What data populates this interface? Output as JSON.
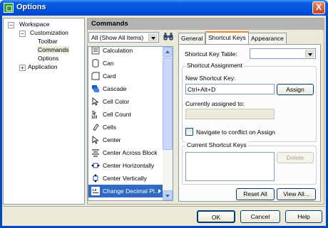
{
  "window": {
    "title": "Options",
    "close_glyph": "X"
  },
  "tree": {
    "workspace": {
      "label": "Workspace",
      "toggle": "−"
    },
    "customization": {
      "label": "Customization",
      "toggle": "−"
    },
    "toolbar": {
      "label": "Toolbar"
    },
    "commands": {
      "label": "Commands"
    },
    "options": {
      "label": "Options"
    },
    "application": {
      "label": "Application",
      "toggle": "+"
    }
  },
  "header": {
    "title": "Commands"
  },
  "filter": {
    "value": "All (Show All Items)"
  },
  "commands": [
    {
      "label": "Calculation",
      "icon": "calculation-icon"
    },
    {
      "label": "Can",
      "icon": "can-icon"
    },
    {
      "label": "Card",
      "icon": "card-icon"
    },
    {
      "label": "Cascade",
      "icon": "cascade-icon"
    },
    {
      "label": "Cell Color",
      "icon": "cell-color-icon"
    },
    {
      "label": "Cell Count",
      "icon": "cell-count-icon"
    },
    {
      "label": "Cells",
      "icon": "cells-icon"
    },
    {
      "label": "Center",
      "icon": "center-icon"
    },
    {
      "label": "Center Across Block",
      "icon": "center-across-block-icon"
    },
    {
      "label": "Center Horizontally",
      "icon": "center-horizontally-icon"
    },
    {
      "label": "Center Vertically",
      "icon": "center-vertically-icon"
    },
    {
      "label": "Change Decimal Pl...",
      "icon": "change-decimal-icon",
      "selected": true
    }
  ],
  "tabs": {
    "general": "General",
    "shortcut_keys": "Shortcut Keys",
    "appearance": "Appearance"
  },
  "shortcut": {
    "table_label": "Shortcut Key Table:",
    "table_value": "",
    "assignment_group": "Shortcut Assignment",
    "new_key_label": "New Shortcut Key:",
    "new_key_value": "Ctrl+Alt+D",
    "assign_button": "Assign",
    "currently_assigned_label": "Currently assigned to:",
    "currently_assigned_value": "",
    "navigate_label": "Navigate to conflict on Assign",
    "current_keys_group": "Current Shortcut Keys",
    "delete_button": "Delete",
    "reset_all_button": "Reset All",
    "view_all_button": "View All..."
  },
  "footer": {
    "ok": "OK",
    "cancel": "Cancel",
    "help": "Help"
  },
  "colors": {
    "titlebar": "#0054e3",
    "selection": "#316ac5",
    "panel": "#ece9d8",
    "header": "#b4b4b4"
  }
}
